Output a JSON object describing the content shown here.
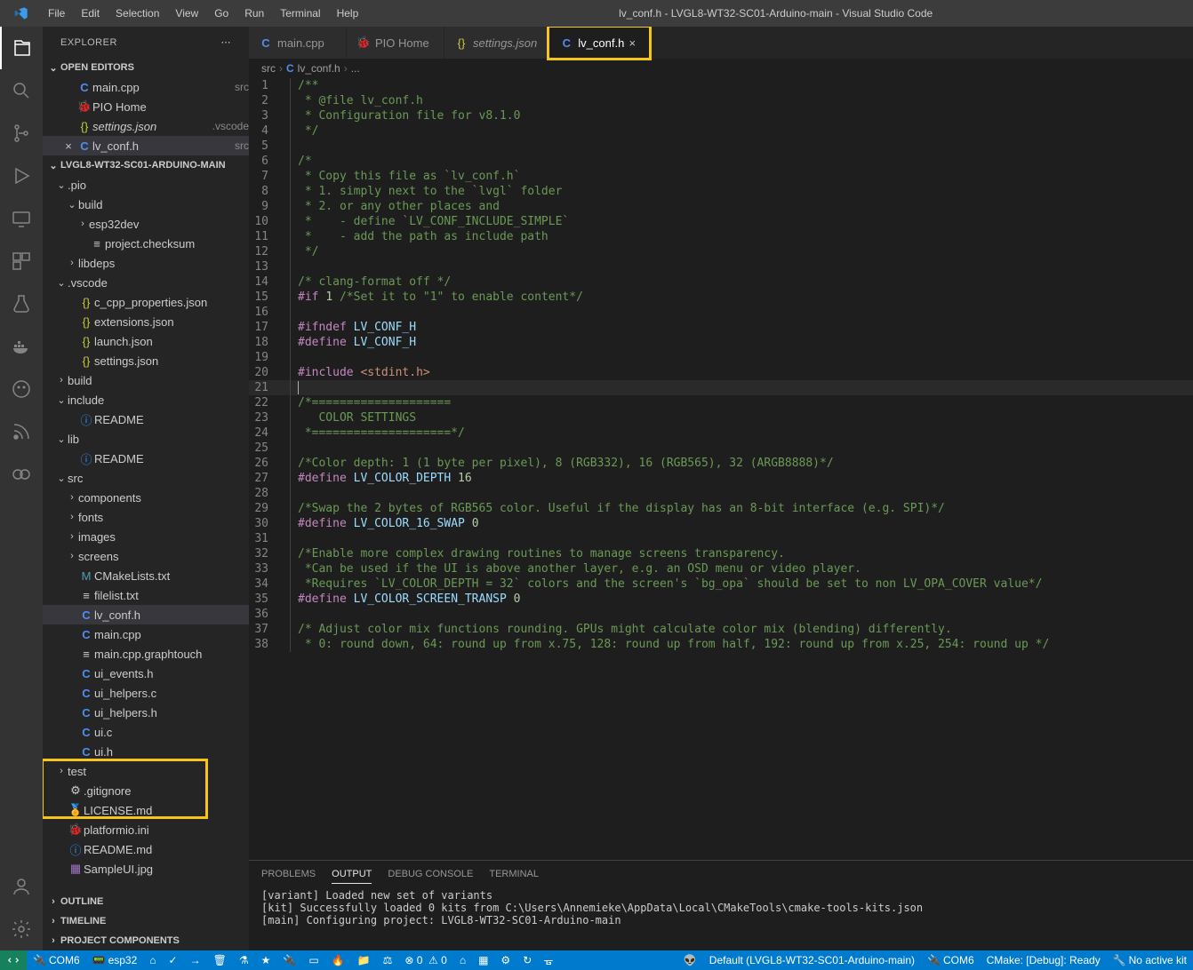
{
  "title": "lv_conf.h - LVGL8-WT32-SC01-Arduino-main - Visual Studio Code",
  "menus": [
    "File",
    "Edit",
    "Selection",
    "View",
    "Go",
    "Run",
    "Terminal",
    "Help"
  ],
  "sidebar": {
    "header": "EXPLORER",
    "openEditors": "OPEN EDITORS",
    "project": "LVGL8-WT32-SC01-ARDUINO-MAIN",
    "outline": "OUTLINE",
    "timeline": "TIMELINE",
    "projectComponents": "PROJECT COMPONENTS",
    "editors": [
      {
        "icon": "C",
        "iconCls": "file-c",
        "label": "main.cpp",
        "meta": "src"
      },
      {
        "icon": "🐞",
        "iconCls": "file-pio",
        "label": "PIO Home",
        "meta": ""
      },
      {
        "icon": "{}",
        "iconCls": "file-json",
        "label": "settings.json",
        "meta": ".vscode",
        "italic": true
      },
      {
        "icon": "C",
        "iconCls": "file-c",
        "label": "lv_conf.h",
        "meta": "src",
        "active": true,
        "close": true
      }
    ],
    "tree": [
      {
        "d": 0,
        "tw": "v",
        "label": ".pio"
      },
      {
        "d": 1,
        "tw": "v",
        "label": "build"
      },
      {
        "d": 2,
        "tw": ">",
        "label": "esp32dev"
      },
      {
        "d": 2,
        "fi": "≡",
        "label": "project.checksum"
      },
      {
        "d": 1,
        "tw": ">",
        "label": "libdeps"
      },
      {
        "d": 0,
        "tw": "v",
        "label": ".vscode"
      },
      {
        "d": 1,
        "fi": "{}",
        "fiCls": "file-json",
        "label": "c_cpp_properties.json"
      },
      {
        "d": 1,
        "fi": "{}",
        "fiCls": "file-json",
        "label": "extensions.json"
      },
      {
        "d": 1,
        "fi": "{}",
        "fiCls": "file-json",
        "label": "launch.json"
      },
      {
        "d": 1,
        "fi": "{}",
        "fiCls": "file-json",
        "label": "settings.json"
      },
      {
        "d": 0,
        "tw": ">",
        "label": "build"
      },
      {
        "d": 0,
        "tw": "v",
        "label": "include"
      },
      {
        "d": 1,
        "fi": "ⓘ",
        "fiCls": "file-info",
        "label": "README"
      },
      {
        "d": 0,
        "tw": "v",
        "label": "lib"
      },
      {
        "d": 1,
        "fi": "ⓘ",
        "fiCls": "file-info",
        "label": "README"
      },
      {
        "d": 0,
        "tw": "v",
        "label": "src"
      },
      {
        "d": 1,
        "tw": ">",
        "label": "components"
      },
      {
        "d": 1,
        "tw": ">",
        "label": "fonts"
      },
      {
        "d": 1,
        "tw": ">",
        "label": "images"
      },
      {
        "d": 1,
        "tw": ">",
        "label": "screens"
      },
      {
        "d": 1,
        "fi": "M",
        "fiCls": "file-md2",
        "label": "CMakeLists.txt"
      },
      {
        "d": 1,
        "fi": "≡",
        "label": "filelist.txt",
        "hl": true
      },
      {
        "d": 1,
        "fi": "C",
        "fiCls": "file-c",
        "label": "lv_conf.h",
        "active": true,
        "hl": true
      },
      {
        "d": 1,
        "fi": "C",
        "fiCls": "file-c",
        "label": "main.cpp",
        "hl": true
      },
      {
        "d": 1,
        "fi": "≡",
        "label": "main.cpp.graphtouch"
      },
      {
        "d": 1,
        "fi": "C",
        "fiCls": "file-c",
        "label": "ui_events.h"
      },
      {
        "d": 1,
        "fi": "C",
        "fiCls": "file-c",
        "label": "ui_helpers.c"
      },
      {
        "d": 1,
        "fi": "C",
        "fiCls": "file-c",
        "label": "ui_helpers.h"
      },
      {
        "d": 1,
        "fi": "C",
        "fiCls": "file-c",
        "label": "ui.c"
      },
      {
        "d": 1,
        "fi": "C",
        "fiCls": "file-c",
        "label": "ui.h"
      },
      {
        "d": 0,
        "tw": ">",
        "label": "test"
      },
      {
        "d": 0,
        "fi": "⚙",
        "label": ".gitignore"
      },
      {
        "d": 0,
        "fi": "🏅",
        "fiCls": "file-fire",
        "label": "LICENSE.md"
      },
      {
        "d": 0,
        "fi": "🐞",
        "fiCls": "file-pio",
        "label": "platformio.ini"
      },
      {
        "d": 0,
        "fi": "ⓘ",
        "fiCls": "file-info",
        "label": "README.md"
      },
      {
        "d": 0,
        "fi": "▦",
        "fiCls": "file-img",
        "label": "SampleUI.jpg"
      }
    ]
  },
  "tabs": [
    {
      "icon": "C",
      "iconCls": "file-c",
      "label": "main.cpp"
    },
    {
      "icon": "🐞",
      "iconCls": "file-pio",
      "label": "PIO Home"
    },
    {
      "icon": "{}",
      "iconCls": "file-json",
      "label": "settings.json",
      "italic": true
    },
    {
      "icon": "C",
      "iconCls": "file-c",
      "label": "lv_conf.h",
      "active": true,
      "close": true,
      "hl": true
    }
  ],
  "breadcrumb": [
    "src",
    "lv_conf.h",
    "..."
  ],
  "code": [
    {
      "n": 1,
      "t": "/**",
      "cls": "tok-c"
    },
    {
      "n": 2,
      "t": " * @file lv_conf.h",
      "cls": "tok-c"
    },
    {
      "n": 3,
      "t": " * Configuration file for v8.1.0",
      "cls": "tok-c"
    },
    {
      "n": 4,
      "t": " */",
      "cls": "tok-c"
    },
    {
      "n": 5,
      "t": ""
    },
    {
      "n": 6,
      "t": "/*",
      "cls": "tok-c"
    },
    {
      "n": 7,
      "t": " * Copy this file as `lv_conf.h`",
      "cls": "tok-c"
    },
    {
      "n": 8,
      "t": " * 1. simply next to the `lvgl` folder",
      "cls": "tok-c"
    },
    {
      "n": 9,
      "t": " * 2. or any other places and",
      "cls": "tok-c"
    },
    {
      "n": 10,
      "t": " *    - define `LV_CONF_INCLUDE_SIMPLE`",
      "cls": "tok-c"
    },
    {
      "n": 11,
      "t": " *    - add the path as include path",
      "cls": "tok-c"
    },
    {
      "n": 12,
      "t": " */",
      "cls": "tok-c"
    },
    {
      "n": 13,
      "t": ""
    },
    {
      "n": 14,
      "t": "/* clang-format off */",
      "cls": "tok-c"
    },
    {
      "n": 15,
      "html": "<span class='tok-kw'>#if</span> <span class='tok-num'>1</span> <span class='tok-c'>/*Set it to \"1\" to enable content*/</span>"
    },
    {
      "n": 16,
      "t": ""
    },
    {
      "n": 17,
      "html": "<span class='tok-kw'>#ifndef</span> <span class='tok-def'>LV_CONF_H</span>"
    },
    {
      "n": 18,
      "html": "<span class='tok-kw'>#define</span> <span class='tok-def'>LV_CONF_H</span>"
    },
    {
      "n": 19,
      "t": ""
    },
    {
      "n": 20,
      "html": "<span class='tok-kw'>#include</span> <span class='tok-str'>&lt;stdint.h&gt;</span>"
    },
    {
      "n": 21,
      "t": "",
      "cursor": true
    },
    {
      "n": 22,
      "t": "/*====================",
      "cls": "tok-c"
    },
    {
      "n": 23,
      "t": "   COLOR SETTINGS",
      "cls": "tok-c"
    },
    {
      "n": 24,
      "t": " *====================*/",
      "cls": "tok-c"
    },
    {
      "n": 25,
      "t": ""
    },
    {
      "n": 26,
      "t": "/*Color depth: 1 (1 byte per pixel), 8 (RGB332), 16 (RGB565), 32 (ARGB8888)*/",
      "cls": "tok-c"
    },
    {
      "n": 27,
      "html": "<span class='tok-kw'>#define</span> <span class='tok-def'>LV_COLOR_DEPTH</span> <span class='tok-num'>16</span>"
    },
    {
      "n": 28,
      "t": ""
    },
    {
      "n": 29,
      "t": "/*Swap the 2 bytes of RGB565 color. Useful if the display has an 8-bit interface (e.g. SPI)*/",
      "cls": "tok-c"
    },
    {
      "n": 30,
      "html": "<span class='tok-kw'>#define</span> <span class='tok-def'>LV_COLOR_16_SWAP</span> <span class='tok-num'>0</span>"
    },
    {
      "n": 31,
      "t": ""
    },
    {
      "n": 32,
      "t": "/*Enable more complex drawing routines to manage screens transparency.",
      "cls": "tok-c"
    },
    {
      "n": 33,
      "t": " *Can be used if the UI is above another layer, e.g. an OSD menu or video player.",
      "cls": "tok-c"
    },
    {
      "n": 34,
      "t": " *Requires `LV_COLOR_DEPTH = 32` colors and the screen's `bg_opa` should be set to non LV_OPA_COVER value*/",
      "cls": "tok-c"
    },
    {
      "n": 35,
      "html": "<span class='tok-kw'>#define</span> <span class='tok-def'>LV_COLOR_SCREEN_TRANSP</span> <span class='tok-num'>0</span>"
    },
    {
      "n": 36,
      "t": ""
    },
    {
      "n": 37,
      "t": "/* Adjust color mix functions rounding. GPUs might calculate color mix (blending) differently.",
      "cls": "tok-c"
    },
    {
      "n": 38,
      "t": " * 0: round down, 64: round up from x.75, 128: round up from half, 192: round up from x.25, 254: round up */",
      "cls": "tok-c"
    }
  ],
  "panel": {
    "tabs": [
      "PROBLEMS",
      "OUTPUT",
      "DEBUG CONSOLE",
      "TERMINAL"
    ],
    "active": 1,
    "lines": [
      "[variant] Loaded new set of variants",
      "[kit] Successfully loaded 0 kits from C:\\Users\\Annemieke\\AppData\\Local\\CMakeTools\\cmake-tools-kits.json",
      "[main] Configuring project: LVGL8-WT32-SC01-Arduino-main "
    ]
  },
  "status": {
    "left": [
      "COM6",
      "esp32"
    ],
    "right": [
      "Default (LVGL8-WT32-SC01-Arduino-main)",
      "COM6",
      "CMake: [Debug]: Ready",
      "No active kit"
    ],
    "errWarn": "0  0"
  }
}
